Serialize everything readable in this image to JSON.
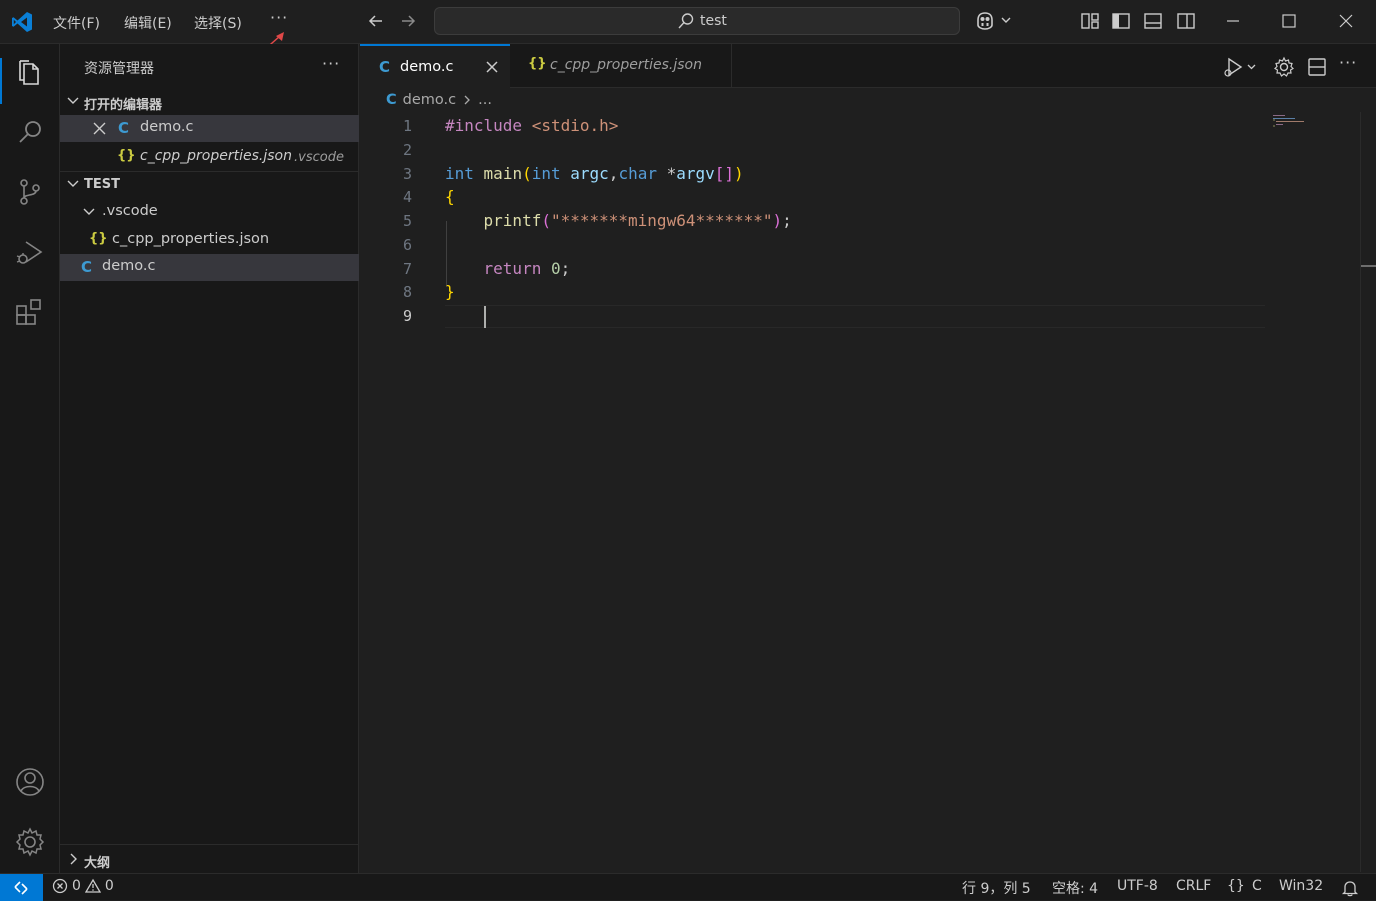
{
  "titlebar": {
    "menu": [
      "文件(F)",
      "编辑(E)",
      "选择(S)"
    ],
    "more": "···",
    "search_text": "test"
  },
  "sidebar": {
    "title": "资源管理器",
    "more": "···",
    "open_editors": {
      "heading": "打开的编辑器",
      "items": [
        {
          "icon": "C",
          "name": "demo.c",
          "desc": ""
        },
        {
          "icon": "{}",
          "name": "c_cpp_properties.json",
          "desc": ".vscode"
        }
      ]
    },
    "workspace": {
      "heading": "TEST",
      "folder": ".vscode",
      "folder_file": {
        "icon": "{}",
        "name": "c_cpp_properties.json"
      },
      "file": {
        "icon": "C",
        "name": "demo.c"
      }
    },
    "outline_heading": "大纲"
  },
  "tabs": [
    {
      "icon": "C",
      "name": "demo.c"
    },
    {
      "icon": "{}",
      "name": "c_cpp_properties.json"
    }
  ],
  "breadcrumb": {
    "icon": "C",
    "file": "demo.c",
    "rest": "..."
  },
  "editor": {
    "line_numbers": [
      "1",
      "2",
      "3",
      "4",
      "5",
      "6",
      "7",
      "8",
      "9"
    ]
  },
  "status": {
    "errors": "0",
    "warnings": "0",
    "position": "行 9，列 5",
    "spaces": "空格: 4",
    "encoding": "UTF-8",
    "eol": "CRLF",
    "lang_icon": "{}",
    "language": "C",
    "config": "Win32"
  }
}
